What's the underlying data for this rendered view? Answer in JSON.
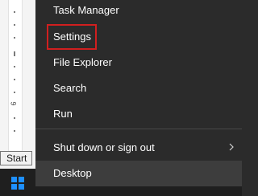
{
  "menu": {
    "items": [
      {
        "label": "Task Manager"
      },
      {
        "label": "Settings"
      },
      {
        "label": "File Explorer"
      },
      {
        "label": "Search"
      },
      {
        "label": "Run"
      },
      {
        "label": "Shut down or sign out"
      },
      {
        "label": "Desktop"
      }
    ]
  },
  "tooltip": {
    "text": "Start"
  },
  "ruler": {
    "number": "9"
  },
  "colors": {
    "menu_bg": "#2b2b2b",
    "highlight": "#d11f1f",
    "windows_blue": "#1e90ff"
  },
  "icons": {
    "submenu": "chevron-right-icon",
    "start": "windows-logo-icon"
  }
}
